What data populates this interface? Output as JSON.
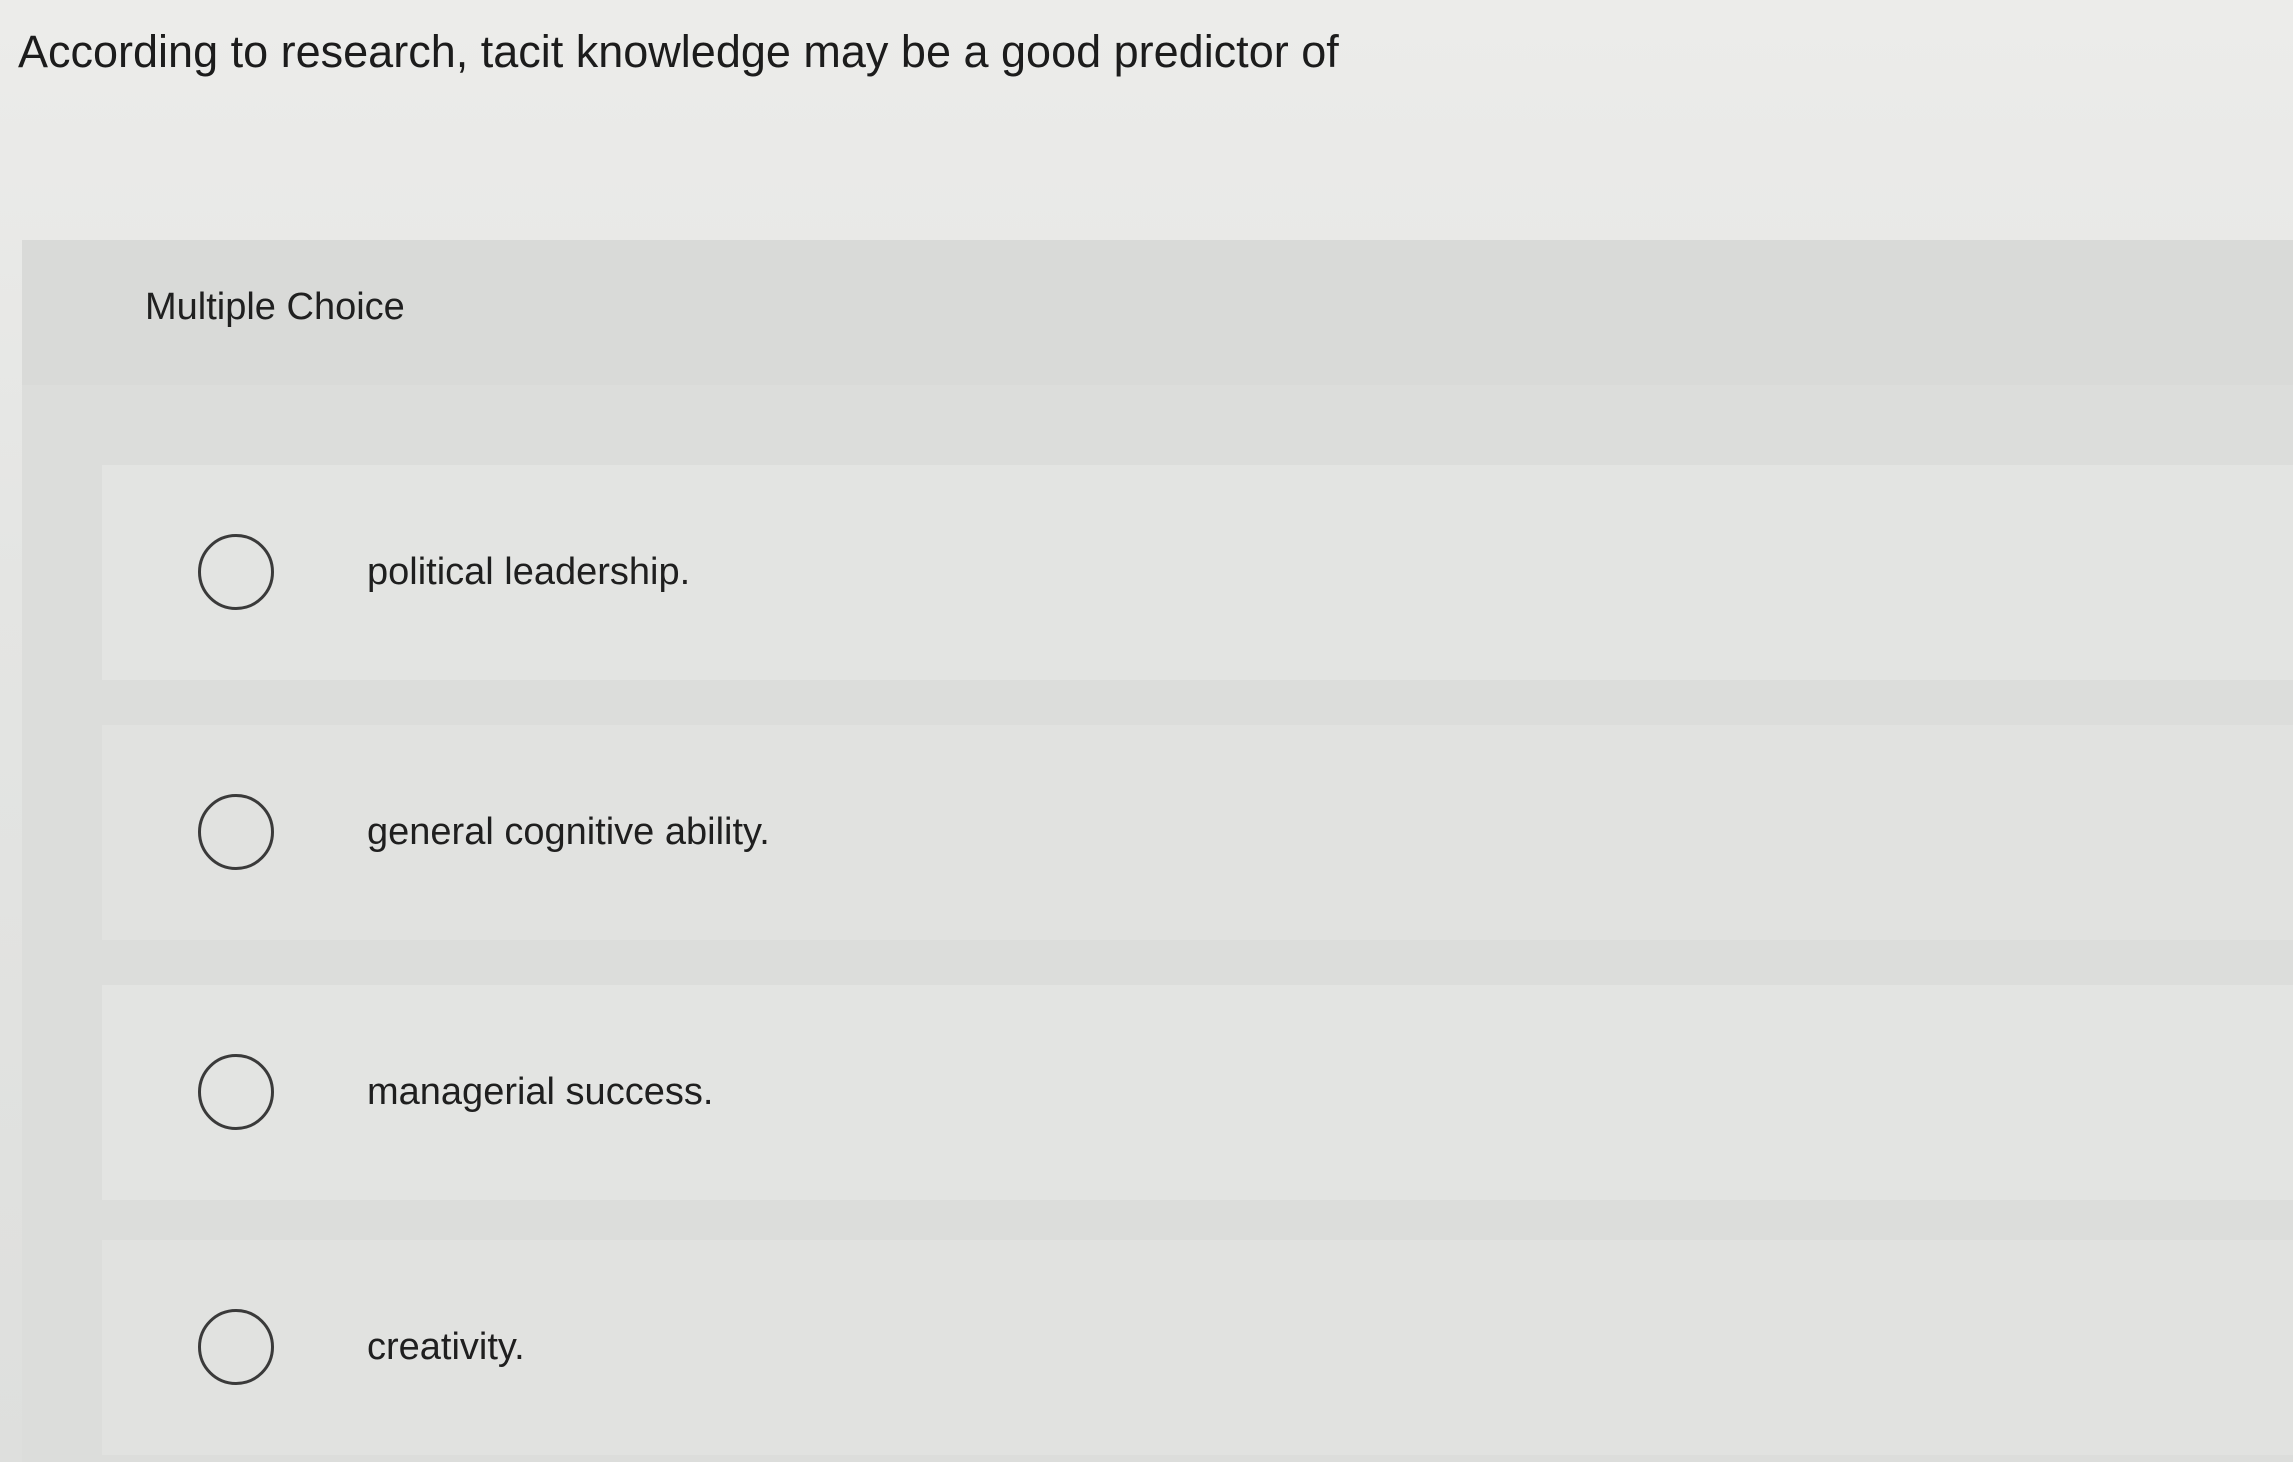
{
  "question": {
    "text": "According to research, tacit knowledge may be a good predictor of"
  },
  "panel": {
    "type_label": "Multiple Choice"
  },
  "options": [
    {
      "label": "political leadership.",
      "selected": false
    },
    {
      "label": "general cognitive ability.",
      "selected": false
    },
    {
      "label": "managerial success.",
      "selected": false
    },
    {
      "label": "creativity.",
      "selected": false
    }
  ],
  "colors": {
    "background": "#e4e5e3",
    "panel": "#dcdddb",
    "radio_border": "#3a3a3a",
    "text": "#1f1f1f"
  }
}
